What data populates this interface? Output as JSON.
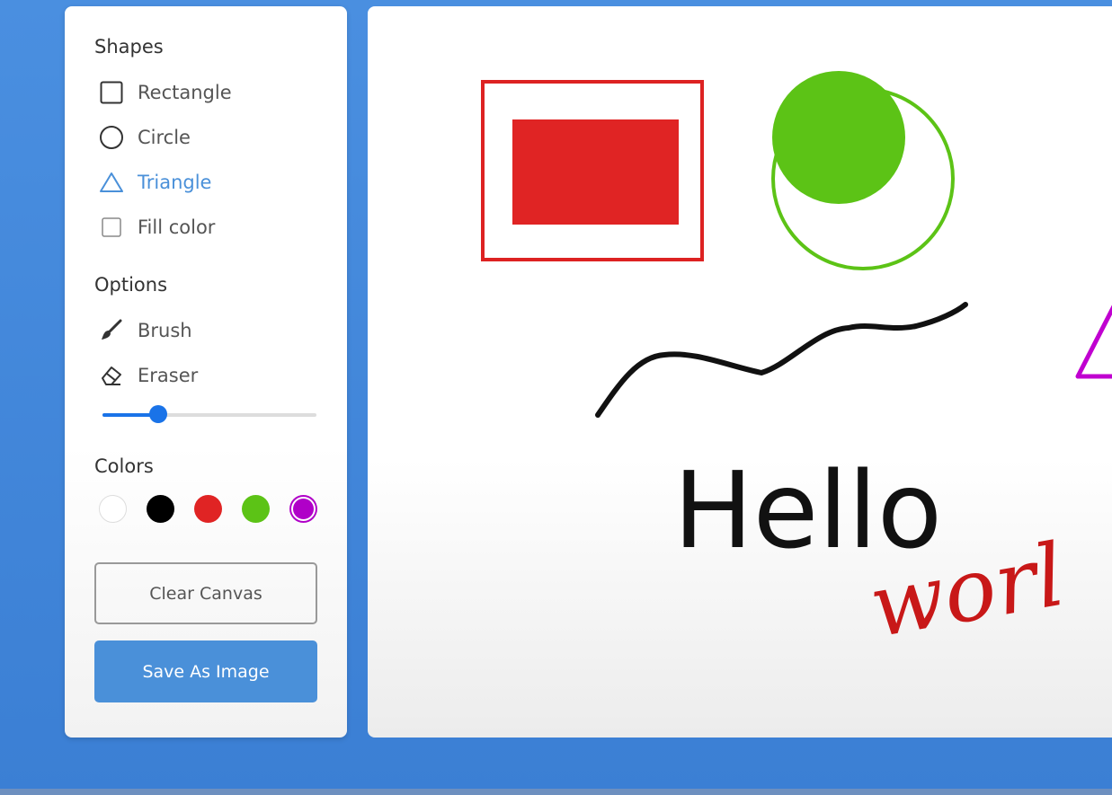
{
  "sidebar": {
    "shapes_title": "Shapes",
    "shapes": [
      {
        "label": "Rectangle",
        "icon": "square-icon"
      },
      {
        "label": "Circle",
        "icon": "circle-icon"
      },
      {
        "label": "Triangle",
        "icon": "triangle-icon",
        "active": true
      }
    ],
    "fill_color_label": "Fill color",
    "fill_color_checked": false,
    "options_title": "Options",
    "options": [
      {
        "label": "Brush",
        "icon": "brush-icon"
      },
      {
        "label": "Eraser",
        "icon": "eraser-icon"
      }
    ],
    "brush_size_fraction": 0.26,
    "colors_title": "Colors",
    "colors": [
      "#ffffff",
      "#000000",
      "#e02424",
      "#5cc316",
      "#b000c8"
    ],
    "selected_color": "#b000c8",
    "clear_label": "Clear Canvas",
    "save_label": "Save As Image"
  },
  "canvas": {
    "text_black": "Hello",
    "text_red": "worl",
    "accent": "#4a90d9"
  }
}
